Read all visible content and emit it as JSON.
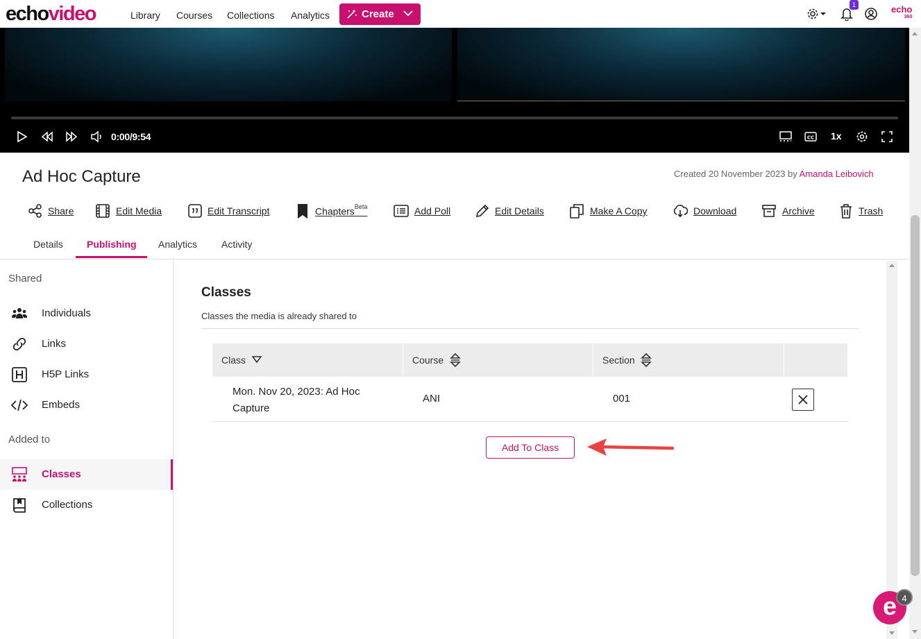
{
  "brand": {
    "logo_part1": "echo",
    "logo_part2": "video",
    "corner_logo": "echo",
    "corner_logo_sub": "360"
  },
  "nav": {
    "links": [
      "Library",
      "Courses",
      "Collections",
      "Analytics"
    ],
    "create_label": "Create",
    "notification_count": "1"
  },
  "player": {
    "time": "0:00/9:54",
    "speed": "1x"
  },
  "media": {
    "title": "Ad Hoc Capture",
    "created_prefix": "Created 20 November 2023 by ",
    "created_author": "Amanda Leibovich"
  },
  "actions": [
    {
      "label": "Share",
      "icon": "share-icon"
    },
    {
      "label": "Edit Media",
      "icon": "film-icon"
    },
    {
      "label": "Edit Transcript",
      "icon": "quote-icon"
    },
    {
      "label": "Chapters",
      "sup": "Beta",
      "icon": "bookmark-icon"
    },
    {
      "label": "Add Poll",
      "icon": "list-icon"
    },
    {
      "label": "Edit Details",
      "icon": "pencil-icon"
    },
    {
      "label": "Make A Copy",
      "icon": "copy-icon"
    },
    {
      "label": "Download",
      "icon": "download-icon"
    },
    {
      "label": "Archive",
      "icon": "archive-icon"
    },
    {
      "label": "Trash",
      "icon": "trash-icon"
    }
  ],
  "tabs": [
    {
      "label": "Details",
      "active": false
    },
    {
      "label": "Publishing",
      "active": true
    },
    {
      "label": "Analytics",
      "active": false
    },
    {
      "label": "Activity",
      "active": false
    }
  ],
  "sidebar": {
    "shared_heading": "Shared",
    "shared_items": [
      {
        "label": "Individuals",
        "icon": "people-icon"
      },
      {
        "label": "Links",
        "icon": "link-icon"
      },
      {
        "label": "H5P Links",
        "icon": "h5p-icon"
      },
      {
        "label": "Embeds",
        "icon": "code-icon"
      }
    ],
    "added_heading": "Added to",
    "added_items": [
      {
        "label": "Classes",
        "icon": "classroom-icon",
        "active": true
      },
      {
        "label": "Collections",
        "icon": "book-icon",
        "active": false
      }
    ]
  },
  "classes": {
    "title": "Classes",
    "subtitle": "Classes the media is already shared to",
    "columns": [
      "Class",
      "Course",
      "Section"
    ],
    "rows": [
      {
        "class": [
          "Mon. Nov 20, 2023: Ad Hoc",
          "Capture"
        ],
        "course": "ANI",
        "section": "001"
      }
    ],
    "add_button": "Add To Class"
  },
  "chat": {
    "count": "4",
    "glyph": "e"
  },
  "colors": {
    "accent": "#c8106f",
    "badge": "#6b2fd6",
    "annotation_arrow": "#e84343"
  }
}
